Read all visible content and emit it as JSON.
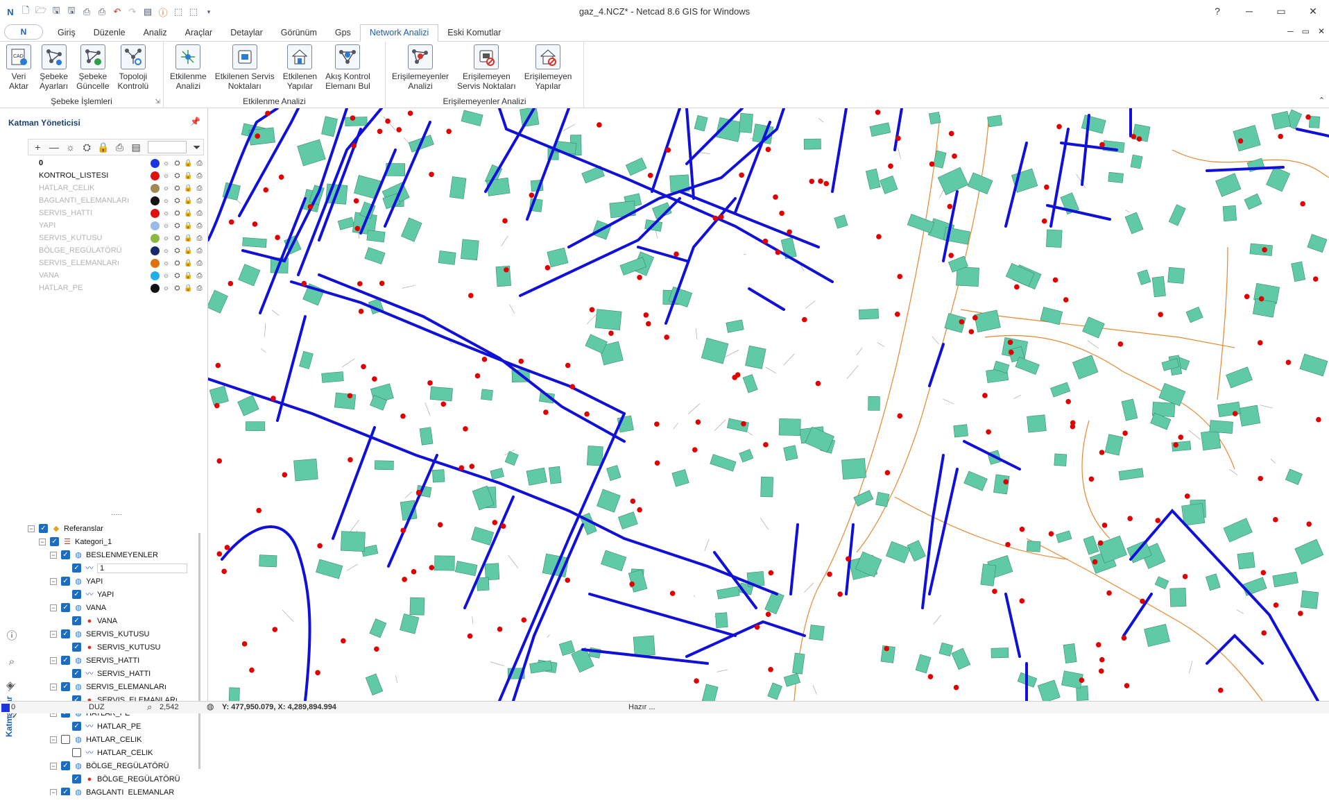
{
  "window": {
    "title": "gaz_4.NCZ* - Netcad 8.6 GIS for Windows",
    "help": "?",
    "minimize": "─",
    "restore": "▭",
    "close": "✕"
  },
  "tabs": [
    "Giriş",
    "Düzenle",
    "Analiz",
    "Araçlar",
    "Detaylar",
    "Görünüm",
    "Gps",
    "Network Analizi",
    "Eski Komutlar"
  ],
  "active_tab": "Network Analizi",
  "ribbon": {
    "groups": [
      {
        "title": "Şebeke İşlemleri",
        "buttons": [
          "Veri\nAktar",
          "Şebeke\nAyarları",
          "Şebeke\nGüncelle",
          "Topoloji\nKontrolü"
        ]
      },
      {
        "title": "Etkilenme Analizi",
        "buttons": [
          "Etkilenme\nAnalizi",
          "Etkilenen Servis\nNoktaları",
          "Etkilenen\nYapılar",
          "Akış Kontrol\nElemanı Bul"
        ]
      },
      {
        "title": "Erişilemeyenler Analizi",
        "buttons": [
          "Erişilemeyenler\nAnalizi",
          "Erişilemeyen\nServis Noktaları",
          "Erişilemeyen\nYapılar"
        ]
      }
    ]
  },
  "layer_manager": {
    "title": "Katman Yöneticisi",
    "layers": [
      {
        "name": "0",
        "color": "#1a35e0",
        "active": true,
        "bold": true
      },
      {
        "name": "KONTROL_LISTESI",
        "color": "#e01010",
        "active": true
      },
      {
        "name": "HATLAR_CELIK",
        "color": "#a08850",
        "active": false
      },
      {
        "name": "BAGLANTI_ELEMANLARı",
        "color": "#111111",
        "active": false
      },
      {
        "name": "SERVIS_HATTI",
        "color": "#e01010",
        "active": false
      },
      {
        "name": "YAPI",
        "color": "#9ab8e8",
        "active": false
      },
      {
        "name": "SERVIS_KUTUSU",
        "color": "#8ab840",
        "active": false
      },
      {
        "name": "BÖLGE_REGÜLATÖRÜ",
        "color": "#152a6a",
        "active": false
      },
      {
        "name": "SERVIS_ELEMANLARı",
        "color": "#e07010",
        "active": false
      },
      {
        "name": "VANA",
        "color": "#20b0e8",
        "active": false
      },
      {
        "name": "HATLAR_PE",
        "color": "#111111",
        "active": false
      }
    ]
  },
  "tree": [
    {
      "level": 0,
      "label": "Referanslar",
      "checked": true,
      "icon": "layers-icon"
    },
    {
      "level": 1,
      "label": "Kategori_1",
      "checked": true,
      "icon": "list-icon"
    },
    {
      "level": 2,
      "label": "BESLENMEYENLER",
      "checked": true,
      "icon": "globe-icon"
    },
    {
      "level": 3,
      "label": "1",
      "checked": true,
      "icon": "line-icon",
      "editing": true
    },
    {
      "level": 2,
      "label": "YAPI",
      "checked": true,
      "icon": "globe-icon"
    },
    {
      "level": 3,
      "label": "YAPI",
      "checked": true,
      "icon": "line-icon"
    },
    {
      "level": 2,
      "label": "VANA",
      "checked": true,
      "icon": "globe-icon"
    },
    {
      "level": 3,
      "label": "VANA",
      "checked": true,
      "icon": "point-icon"
    },
    {
      "level": 2,
      "label": "SERVIS_KUTUSU",
      "checked": true,
      "icon": "globe-icon"
    },
    {
      "level": 3,
      "label": "SERVIS_KUTUSU",
      "checked": true,
      "icon": "point-icon"
    },
    {
      "level": 2,
      "label": "SERVIS_HATTI",
      "checked": true,
      "icon": "globe-icon"
    },
    {
      "level": 3,
      "label": "SERVIS_HATTI",
      "checked": true,
      "icon": "line-icon"
    },
    {
      "level": 2,
      "label": "SERVIS_ELEMANLARı",
      "checked": true,
      "icon": "globe-icon"
    },
    {
      "level": 3,
      "label": "SERVIS_ELEMANLARı",
      "checked": true,
      "icon": "point-icon"
    },
    {
      "level": 2,
      "label": "HATLAR_PE",
      "checked": true,
      "icon": "globe-icon"
    },
    {
      "level": 3,
      "label": "HATLAR_PE",
      "checked": true,
      "icon": "line-icon"
    },
    {
      "level": 2,
      "label": "HATLAR_CELIK",
      "checked": false,
      "icon": "globe-icon"
    },
    {
      "level": 3,
      "label": "HATLAR_CELIK",
      "checked": false,
      "icon": "line-icon"
    },
    {
      "level": 2,
      "label": "BÖLGE_REGÜLATÖRÜ",
      "checked": true,
      "icon": "globe-icon"
    },
    {
      "level": 3,
      "label": "BÖLGE_REGÜLATÖRÜ",
      "checked": true,
      "icon": "point-icon"
    },
    {
      "level": 2,
      "label": "BAGLANTI_ELEMANLAR",
      "checked": true,
      "icon": "globe-icon"
    }
  ],
  "side_tab": "Katmanlar",
  "status": {
    "layer": "0",
    "mode": "DUZ",
    "zoom": "2,542",
    "coords": "Y: 477,950.079, X: 4,289,894.994",
    "state": "Hazır ..."
  },
  "map": {
    "pipe_color": "#1010d8",
    "building_color": "#5fcaa5",
    "service_color": "#e9862f",
    "point_color": "#e00000"
  }
}
